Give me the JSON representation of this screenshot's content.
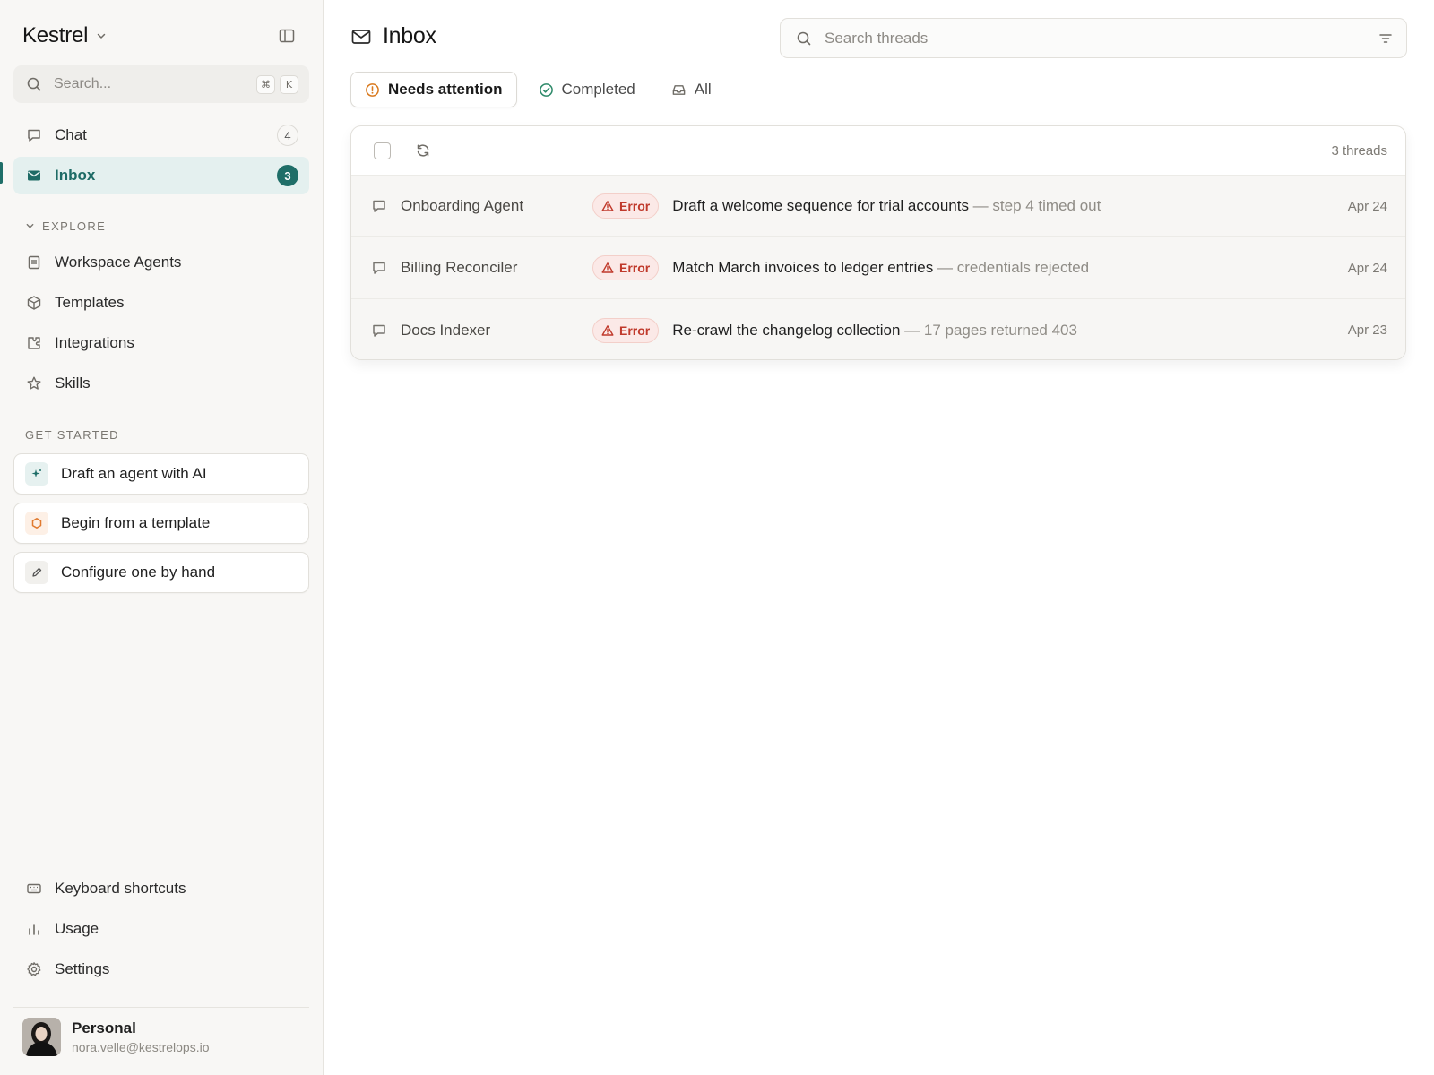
{
  "app": {
    "name": "Kestrel"
  },
  "sidebar": {
    "search_placeholder": "Search...",
    "search_shortcut": [
      "⌘",
      "K"
    ],
    "nav": [
      {
        "label": "Chat",
        "icon": "chat-bubble-icon",
        "count": "4"
      },
      {
        "label": "Inbox",
        "icon": "inbox-icon",
        "count": "3",
        "active": true
      }
    ],
    "explore_label": "EXPLORE",
    "explore": [
      {
        "label": "Workspace Agents",
        "icon": "document-icon"
      },
      {
        "label": "Templates",
        "icon": "cube-icon"
      },
      {
        "label": "Integrations",
        "icon": "puzzle-icon"
      },
      {
        "label": "Skills",
        "icon": "star-icon"
      }
    ],
    "get_started_label": "GET STARTED",
    "get_started": [
      {
        "label": "Draft an agent with AI",
        "icon": "sparkle-icon",
        "color": "#1f6e68"
      },
      {
        "label": "Begin from a template",
        "icon": "hexagon-icon",
        "color": "#e07a2f"
      },
      {
        "label": "Configure one by hand",
        "icon": "pencil-icon",
        "color": "#555555"
      }
    ],
    "footer": [
      {
        "label": "Keyboard shortcuts",
        "icon": "keyboard-icon"
      },
      {
        "label": "Usage",
        "icon": "bar-chart-icon"
      },
      {
        "label": "Settings",
        "icon": "gear-icon"
      }
    ],
    "profile": {
      "name": "Personal",
      "email": "nora.velle@kestrelops.io"
    }
  },
  "main": {
    "title": "Inbox",
    "search_placeholder": "Search threads",
    "tabs": [
      {
        "label": "Needs attention",
        "icon": "alert-circle-icon",
        "active": true
      },
      {
        "label": "Completed",
        "icon": "check-circle-icon"
      },
      {
        "label": "All",
        "icon": "tray-icon"
      }
    ],
    "thread_count": "3 threads",
    "threads": [
      {
        "agent": "Onboarding Agent",
        "status": "Error",
        "subject": "Draft a welcome sequence for trial accounts",
        "detail": " — step 4 timed out",
        "date": "Apr 24"
      },
      {
        "agent": "Billing Reconciler",
        "status": "Error",
        "subject": "Match March invoices to ledger entries",
        "detail": " — credentials rejected",
        "date": "Apr 24"
      },
      {
        "agent": "Docs Indexer",
        "status": "Error",
        "subject": "Re-crawl the changelog collection",
        "detail": " — 17 pages returned 403",
        "date": "Apr 23"
      }
    ]
  },
  "colors": {
    "accent": "#1f6e68",
    "error": "#c0392b",
    "sidebar_bg": "#f8f7f5"
  }
}
